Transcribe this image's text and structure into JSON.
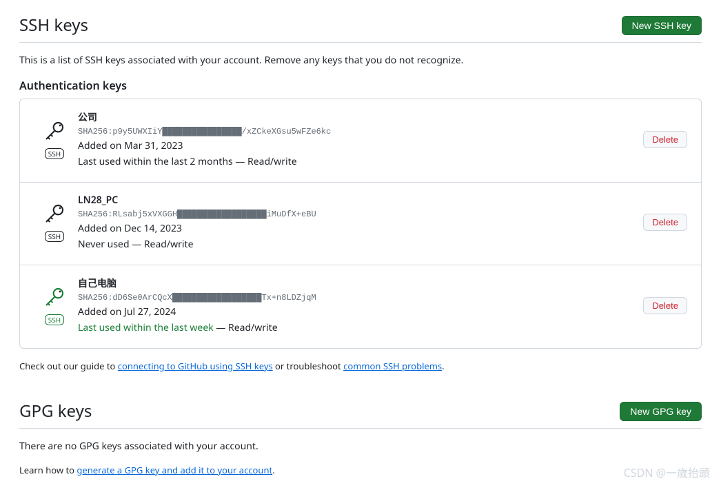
{
  "ssh": {
    "title": "SSH keys",
    "new_button": "New SSH key",
    "intro": "This is a list of SSH keys associated with your account. Remove any keys that you do not recognize.",
    "subheading": "Authentication keys",
    "badge": "SSH",
    "delete_label": "Delete",
    "keys": [
      {
        "name": "公司",
        "fingerprint": "SHA256:p9y5UWXIiY████████████████/xZCkeXGsu5wFZe6kc",
        "added": "Added on Mar 31, 2023",
        "usage": "Last used within the last 2 months",
        "rw": " — Read/write",
        "recent": false
      },
      {
        "name": "LN28_PC",
        "fingerprint": "SHA256:RLsabj5xVXGGH██████████████████iMuDfX+eBU",
        "added": "Added on Dec 14, 2023",
        "usage": "Never used",
        "rw": " — Read/write",
        "recent": false
      },
      {
        "name": "自己电脑",
        "fingerprint": "SHA256:dD6Se0ArCQcX██████████████████Tx+n8LDZjqM",
        "added": "Added on Jul 27, 2024",
        "usage": "Last used within the last week",
        "rw": " — Read/write",
        "recent": true
      }
    ],
    "guide_prefix": "Check out our guide to ",
    "guide_link1": "connecting to GitHub using SSH keys",
    "guide_mid": " or troubleshoot ",
    "guide_link2": "common SSH problems",
    "guide_suffix": "."
  },
  "gpg": {
    "title": "GPG keys",
    "new_button": "New GPG key",
    "empty": "There are no GPG keys associated with your account.",
    "learn_prefix": "Learn how to ",
    "learn_link": "generate a GPG key and add it to your account",
    "learn_suffix": "."
  },
  "watermark": "CSDN @一歲抬頭"
}
